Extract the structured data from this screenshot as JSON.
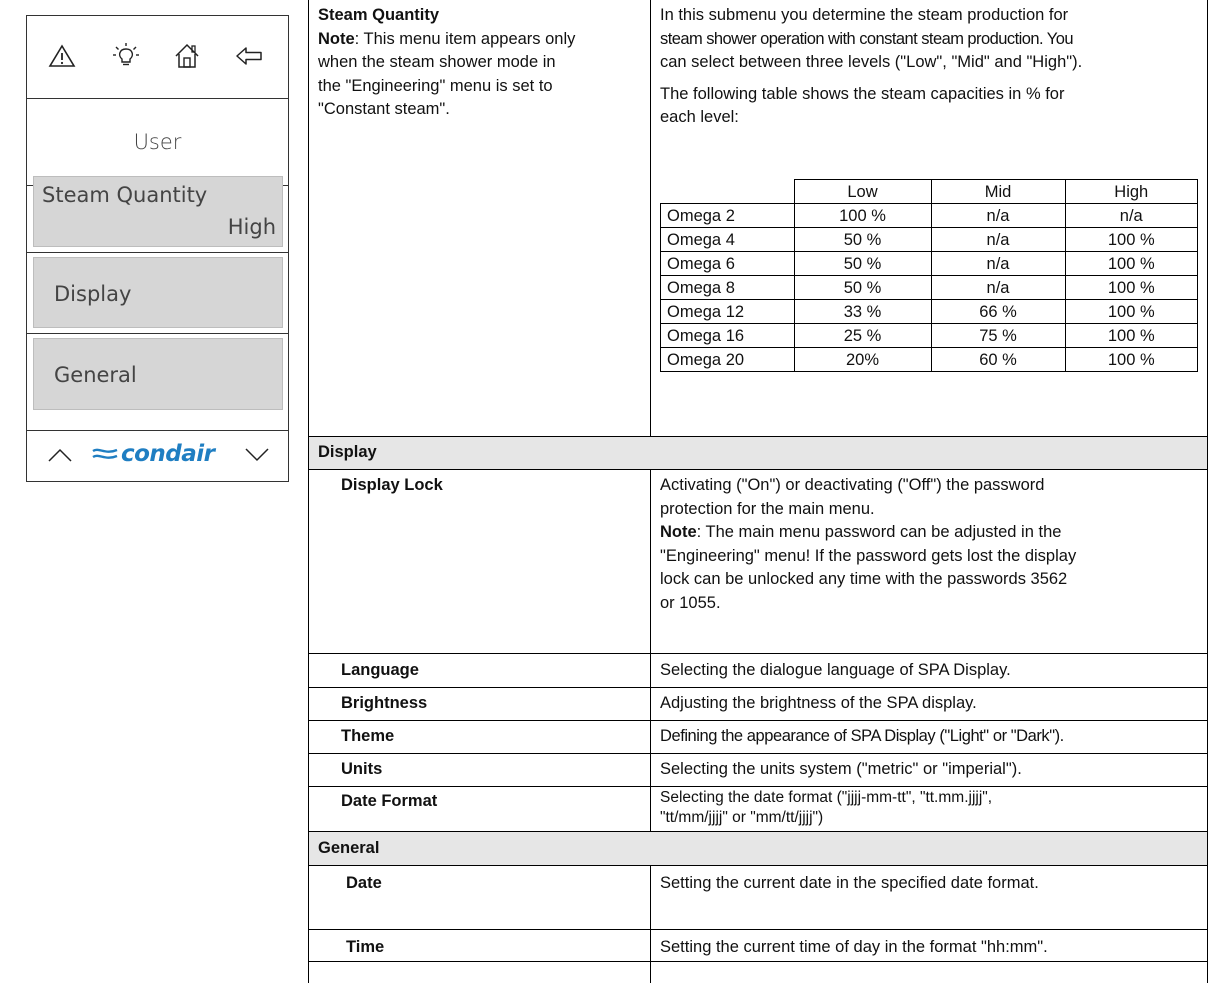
{
  "device": {
    "menu_title": "User",
    "items": [
      {
        "label": "Steam Quantity",
        "value": "High"
      },
      {
        "label": "Display"
      },
      {
        "label": "General"
      }
    ],
    "icons": [
      "warning-icon",
      "lightbulb-icon",
      "home-icon",
      "back-arrow-icon",
      "scroll-up-icon",
      "scroll-down-icon"
    ],
    "logo": "condair",
    "accent_color": "#1f7ec2"
  },
  "steam_quantity": {
    "title": "Steam Quantity",
    "note_label": "Note",
    "note_lines": [
      ": This menu item appears only",
      "when the steam shower mode in",
      "the \"Engineering\" menu is set to",
      "\"Constant steam\"."
    ],
    "desc_lines": [
      "In this submenu you determine the steam production for",
      "steam shower operation with constant steam production. You",
      "can select between three levels (\"Low\", \"Mid\" and \"High\")."
    ],
    "table_intro_lines": [
      "The following table shows the steam capacities in % for",
      "each level:"
    ],
    "capacity_table": {
      "columns": [
        "",
        "Low",
        "Mid",
        "High"
      ],
      "rows": [
        [
          "Omega 2",
          "100 %",
          "n/a",
          "n/a"
        ],
        [
          "Omega 4",
          "50 %",
          "n/a",
          "100 %"
        ],
        [
          "Omega 6",
          "50 %",
          "n/a",
          "100 %"
        ],
        [
          "Omega 8",
          "50 %",
          "n/a",
          "100 %"
        ],
        [
          "Omega 12",
          "33 %",
          "66 %",
          "100 %"
        ],
        [
          "Omega 16",
          "25 %",
          "75 %",
          "100 %"
        ],
        [
          "Omega 20",
          "20%",
          "60 %",
          "100 %"
        ]
      ]
    }
  },
  "display_section": {
    "header": "Display",
    "rows": [
      {
        "name": "Display Lock",
        "lines": [
          "Activating (\"On\") or deactivating (\"Off\")  the password",
          "protection  for the main menu."
        ],
        "note_label": "Note",
        "note_lines": [
          ": The main menu password can be adjusted in the",
          "\"Engineering\" menu! If the password gets lost the display",
          "lock can be unlocked any time with the passwords 3562",
          "or 1055."
        ]
      },
      {
        "name": "Language",
        "lines": [
          "Selecting the dialogue language of SPA Display."
        ]
      },
      {
        "name": "Brightness",
        "lines": [
          "Adjusting the brightness of the SPA display."
        ]
      },
      {
        "name": "Theme",
        "lines": [
          "Defining the appearance of SPA Display (\"Light\" or \"Dark\")."
        ]
      },
      {
        "name": "Units",
        "lines": [
          "Selecting the units system (\"metric\" or \"imperial\")."
        ]
      },
      {
        "name": "Date Format",
        "lines": [
          "Selecting the date format (\"jjjj-mm-tt\", \"tt.mm.jjjj\",",
          "\"tt/mm/jjjj\" or \"mm/tt/jjjj\")"
        ]
      }
    ]
  },
  "general_section": {
    "header": "General",
    "rows": [
      {
        "name": "Date",
        "lines": [
          "Setting the current date in the specified date format."
        ]
      },
      {
        "name": "Time",
        "lines": [
          "Setting the current time of day in the format \"hh:mm\"."
        ]
      }
    ]
  }
}
